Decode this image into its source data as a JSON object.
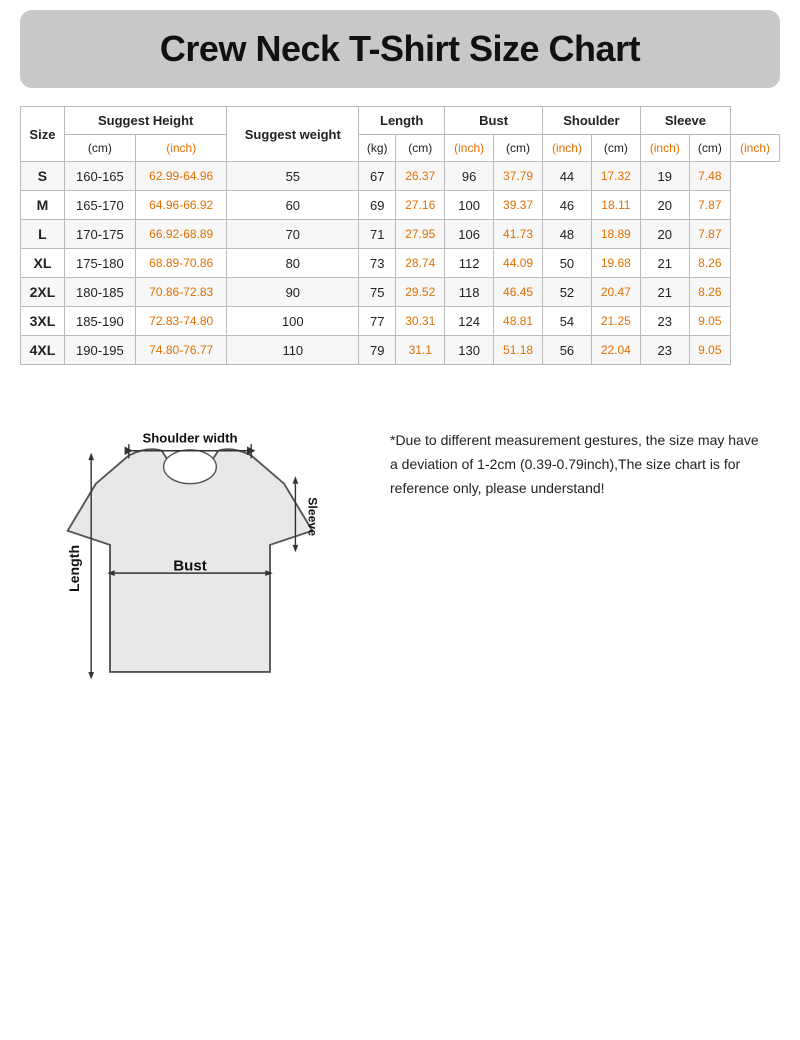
{
  "title": "Crew Neck T-Shirt Size Chart",
  "table": {
    "headers": [
      {
        "label": "Size",
        "rowspan": 2,
        "colspan": 1
      },
      {
        "label": "Suggest Height",
        "rowspan": 1,
        "colspan": 2
      },
      {
        "label": "Suggest weight",
        "rowspan": 1,
        "colspan": 1
      },
      {
        "label": "Length",
        "rowspan": 1,
        "colspan": 2
      },
      {
        "label": "Bust",
        "rowspan": 1,
        "colspan": 2
      },
      {
        "label": "Shoulder",
        "rowspan": 1,
        "colspan": 2
      },
      {
        "label": "Sleeve",
        "rowspan": 1,
        "colspan": 2
      }
    ],
    "units": [
      "(cm)",
      "(inch)",
      "(kg)",
      "(cm)",
      "(inch)",
      "(cm)",
      "(inch)",
      "(cm)",
      "(inch)",
      "(cm)",
      "(inch)"
    ],
    "rows": [
      {
        "size": "S",
        "h_cm": "160-165",
        "h_in": "62.99-64.96",
        "wt": "55",
        "l_cm": "67",
        "l_in": "26.37",
        "b_cm": "96",
        "b_in": "37.79",
        "sh_cm": "44",
        "sh_in": "17.32",
        "sl_cm": "19",
        "sl_in": "7.48"
      },
      {
        "size": "M",
        "h_cm": "165-170",
        "h_in": "64.96-66.92",
        "wt": "60",
        "l_cm": "69",
        "l_in": "27.16",
        "b_cm": "100",
        "b_in": "39.37",
        "sh_cm": "46",
        "sh_in": "18.11",
        "sl_cm": "20",
        "sl_in": "7.87"
      },
      {
        "size": "L",
        "h_cm": "170-175",
        "h_in": "66.92-68.89",
        "wt": "70",
        "l_cm": "71",
        "l_in": "27.95",
        "b_cm": "106",
        "b_in": "41.73",
        "sh_cm": "48",
        "sh_in": "18.89",
        "sl_cm": "20",
        "sl_in": "7.87"
      },
      {
        "size": "XL",
        "h_cm": "175-180",
        "h_in": "68.89-70.86",
        "wt": "80",
        "l_cm": "73",
        "l_in": "28.74",
        "b_cm": "112",
        "b_in": "44.09",
        "sh_cm": "50",
        "sh_in": "19.68",
        "sl_cm": "21",
        "sl_in": "8.26"
      },
      {
        "size": "2XL",
        "h_cm": "180-185",
        "h_in": "70.86-72.83",
        "wt": "90",
        "l_cm": "75",
        "l_in": "29.52",
        "b_cm": "118",
        "b_in": "46.45",
        "sh_cm": "52",
        "sh_in": "20.47",
        "sl_cm": "21",
        "sl_in": "8.26"
      },
      {
        "size": "3XL",
        "h_cm": "185-190",
        "h_in": "72.83-74.80",
        "wt": "100",
        "l_cm": "77",
        "l_in": "30.31",
        "b_cm": "124",
        "b_in": "48.81",
        "sh_cm": "54",
        "sh_in": "21.25",
        "sl_cm": "23",
        "sl_in": "9.05"
      },
      {
        "size": "4XL",
        "h_cm": "190-195",
        "h_in": "74.80-76.77",
        "wt": "110",
        "l_cm": "79",
        "l_in": "31.1",
        "b_cm": "130",
        "b_in": "51.18",
        "sh_cm": "56",
        "sh_in": "22.04",
        "sl_cm": "23",
        "sl_in": "9.05"
      }
    ]
  },
  "diagram": {
    "shoulder_label": "Shoulder width",
    "bust_label": "Bust",
    "length_label": "Length",
    "sleeve_label": "Sleeve"
  },
  "note": "*Due to different measurement gestures, the size may have a deviation of 1-2cm (0.39-0.79inch),The size chart is for reference only, please understand!"
}
